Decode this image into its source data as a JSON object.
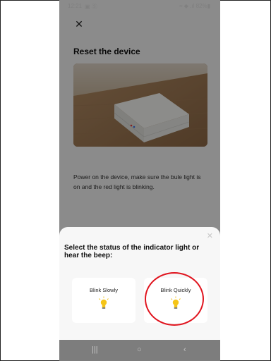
{
  "status_bar": {
    "time": "12:21",
    "icons_left": "▣ Ⓢ",
    "icons_right": "≈ ◆ .ıl 82%▮"
  },
  "page": {
    "title": "Reset the device",
    "instruction": "Power on the device, make sure the bule light is on and the red light is blinking."
  },
  "sheet": {
    "title": "Select the status of the indicator light or hear the beep:",
    "options": [
      {
        "label": "Blink Slowly"
      },
      {
        "label": "Blink Quickly"
      }
    ]
  },
  "nav": {
    "recent": "|||",
    "home": "○",
    "back": "‹"
  },
  "colors": {
    "highlight": "#e0141e",
    "bulb": "#f5c518"
  }
}
